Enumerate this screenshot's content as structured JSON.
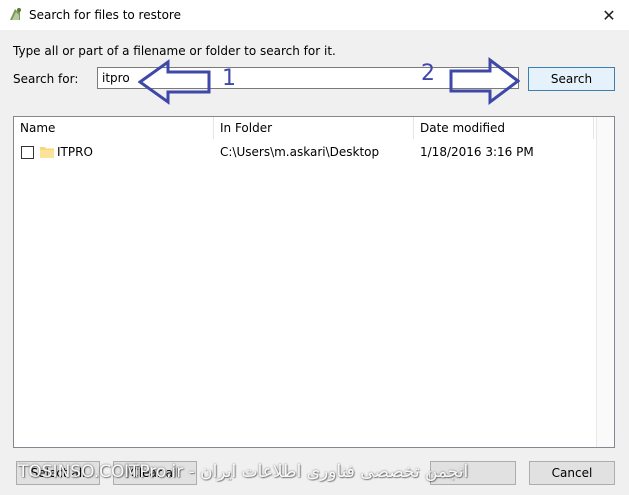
{
  "window": {
    "title": "Search for files to restore",
    "icon": "restore-icon"
  },
  "instruction": "Type all or part of a filename or folder to search for it.",
  "search": {
    "label": "Search for:",
    "value": "itpro",
    "button_label": "Search"
  },
  "annotations": [
    {
      "number": "1"
    },
    {
      "number": "2"
    }
  ],
  "table": {
    "columns": [
      "Name",
      "In Folder",
      "Date modified"
    ],
    "rows": [
      {
        "name": "ITPRO",
        "folder": "C:\\Users\\m.askari\\Desktop",
        "date": "1/18/2016 3:16 PM"
      }
    ]
  },
  "footer": {
    "select_all": "Select all",
    "clear_all": "Clear all",
    "restore": "",
    "cancel": "Cancel"
  },
  "watermarks": {
    "left": "TOSINSO.COM",
    "right": "ITPro.ir - انجمن تخصصی فناوری اطلاعات ایران"
  },
  "colors": {
    "annotation_blue": "#3e48a8",
    "search_button_border": "#3c7fb1",
    "search_button_bg": "#e5f1fb",
    "folder_yellow": "#f8d775"
  }
}
